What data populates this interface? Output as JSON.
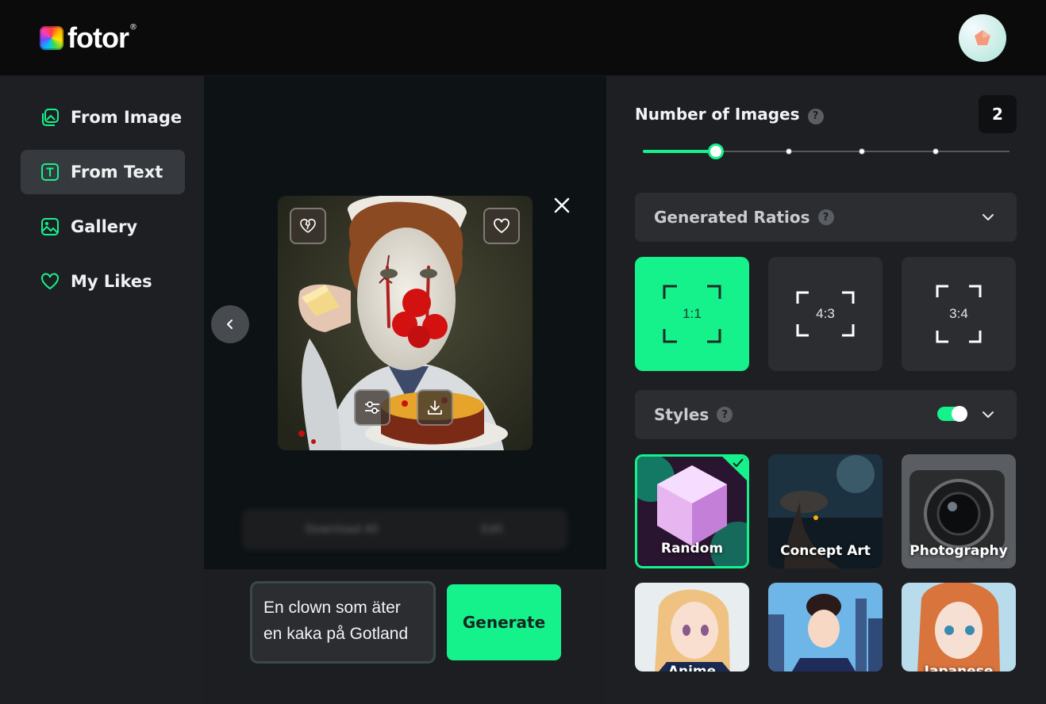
{
  "brand": {
    "name": "fotor",
    "reg": "®"
  },
  "sidebar": {
    "items": [
      {
        "label": "From Image",
        "icon": "image-stack-icon"
      },
      {
        "label": "From Text",
        "icon": "text-box-icon"
      },
      {
        "label": "Gallery",
        "icon": "gallery-icon"
      },
      {
        "label": "My Likes",
        "icon": "heart-icon"
      }
    ],
    "active": "From Text"
  },
  "preview": {
    "blurred_actions": [
      "Download All",
      "Edit"
    ]
  },
  "prompt": {
    "value": "En clown som äter en kaka på Gotland"
  },
  "generate": {
    "label": "Generate"
  },
  "panel": {
    "number_of_images": {
      "label": "Number of Images",
      "help": "?",
      "value": "2",
      "selected_fraction": 0.2
    },
    "ratios": {
      "label": "Generated Ratios",
      "help": "?",
      "options": [
        "1:1",
        "4:3",
        "3:4"
      ],
      "selected": "1:1"
    },
    "styles": {
      "label": "Styles",
      "help": "?",
      "enabled": true,
      "items": [
        "Random",
        "Concept Art",
        "Photography",
        "Anime",
        "",
        "Japanese"
      ],
      "selected": "Random"
    }
  },
  "colors": {
    "accent": "#15f28b",
    "panel": "#1e1f23",
    "card": "#2b2d31"
  }
}
